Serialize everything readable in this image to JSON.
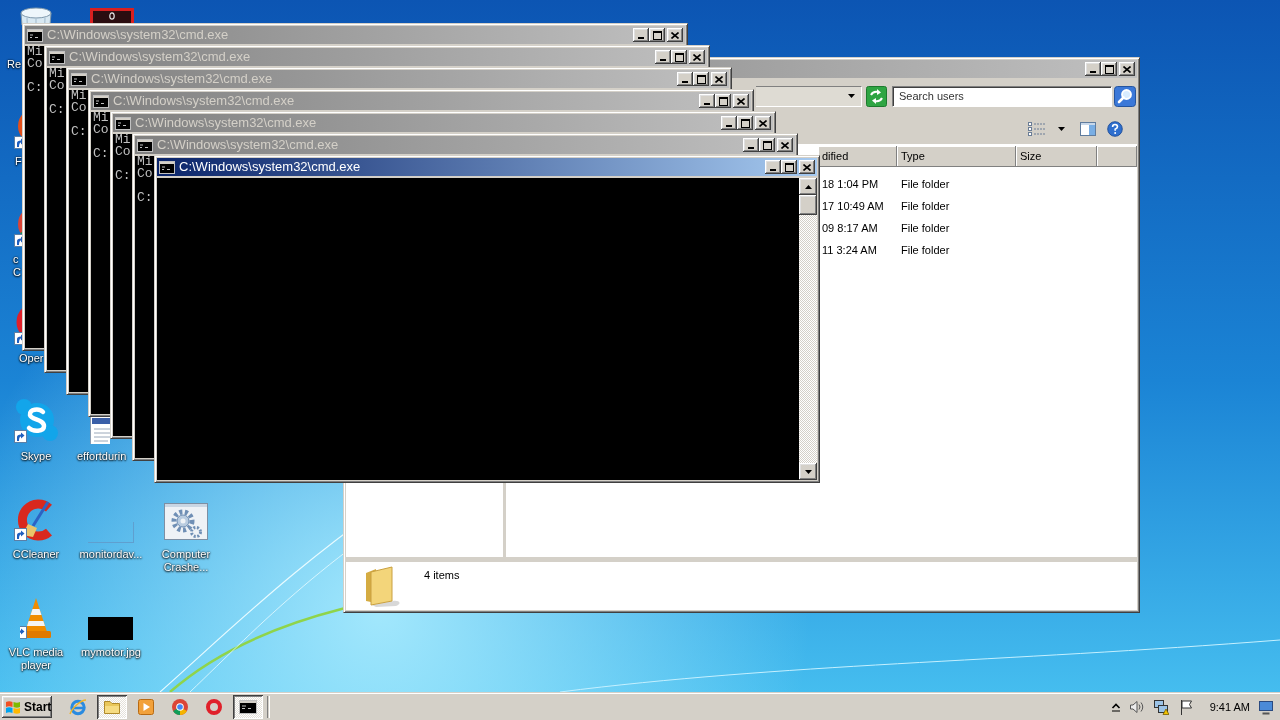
{
  "desktop": {
    "icons": [
      {
        "kind": "bin",
        "label": [
          "Re"
        ]
      },
      {
        "kind": "tile"
      },
      {
        "kind": "orb",
        "label": [
          "F"
        ]
      },
      {
        "kind": "disc",
        "label": [
          "c",
          "C"
        ]
      },
      {
        "kind": "ring",
        "label": [
          "Oper"
        ]
      },
      {
        "kind": "cloud",
        "label": [
          "Skype"
        ]
      },
      {
        "kind": "document",
        "label": [
          "effortdurin"
        ]
      },
      {
        "kind": "arc",
        "label": [
          "CCleaner"
        ]
      },
      {
        "kind": "blank",
        "label": [
          "monitordav..."
        ]
      },
      {
        "kind": "gear",
        "label": [
          "Computer",
          "Crashe..."
        ]
      },
      {
        "kind": "cone",
        "label": [
          "VLC media",
          "player"
        ]
      },
      {
        "kind": "thumbnail",
        "label": [
          "mymotor.jpg"
        ]
      }
    ]
  },
  "explorer": {
    "active": false,
    "search": {
      "placeholder": "Search users"
    },
    "columns": [
      "dified",
      "Type",
      "Size"
    ],
    "rows": [
      [
        "18 1:04 PM",
        "File folder"
      ],
      [
        "17 10:49 AM",
        "File folder"
      ],
      [
        "09 8:17 AM",
        "File folder"
      ],
      [
        "11 3:24 AM",
        "File folder"
      ]
    ],
    "status": "4 items"
  },
  "cmd_windows": [
    {
      "title": "C:\\Windows\\system32\\cmd.exe",
      "active": false,
      "lines": [
        "Mi",
        "Co"
      ],
      "prompt": "C:"
    },
    {
      "title": "C:\\Windows\\system32\\cmd.exe",
      "active": false,
      "lines": [
        "Mi",
        "Co"
      ],
      "prompt": "C:"
    },
    {
      "title": "C:\\Windows\\system32\\cmd.exe",
      "active": false,
      "lines": [
        "Mi",
        "Co"
      ],
      "prompt": "C:"
    },
    {
      "title": "C:\\Windows\\system32\\cmd.exe",
      "active": false,
      "lines": [
        "Mi",
        "Co"
      ],
      "prompt": "C:"
    },
    {
      "title": "C:\\Windows\\system32\\cmd.exe",
      "active": false,
      "lines": [
        "Mi",
        "Co"
      ],
      "prompt": "C:"
    },
    {
      "title": "C:\\Windows\\system32\\cmd.exe",
      "active": false,
      "lines": [
        "Mi",
        "Co"
      ],
      "prompt": "C:"
    },
    {
      "title": "C:\\Windows\\system32\\cmd.exe",
      "active": true
    }
  ],
  "taskbar": {
    "start": "Start",
    "buttons": [
      {
        "kind": "globe",
        "pressed": false
      },
      {
        "kind": "folder",
        "pressed": true
      },
      {
        "kind": "player",
        "pressed": false
      },
      {
        "kind": "disc",
        "pressed": false
      },
      {
        "kind": "ring",
        "pressed": false
      },
      {
        "kind": "console",
        "pressed": true
      }
    ],
    "clock": "9:41 AM"
  }
}
